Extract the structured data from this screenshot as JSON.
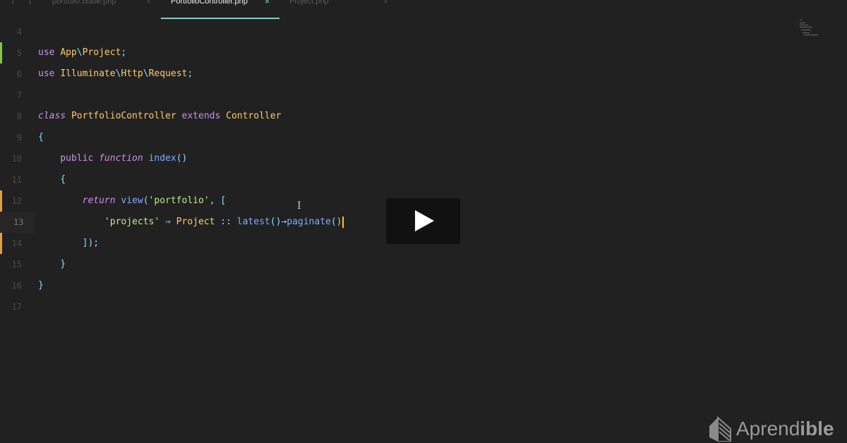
{
  "tabs": [
    {
      "label": "portfolio.blade.php",
      "active": false
    },
    {
      "label": "PortfolioController.php",
      "active": true
    },
    {
      "label": "Project.php",
      "active": false
    }
  ],
  "close_glyph": "×",
  "nav": {
    "back": "‹",
    "forward": "›"
  },
  "editor": {
    "current_line": 13,
    "lines": [
      {
        "n": "4",
        "tokens": []
      },
      {
        "n": "5",
        "gutter": "#8bc34a",
        "tokens": [
          [
            "use ",
            "k"
          ],
          [
            "App",
            "c"
          ],
          [
            "\\",
            "p"
          ],
          [
            "Project",
            "c"
          ],
          [
            ";",
            "p"
          ]
        ]
      },
      {
        "n": "6",
        "tokens": [
          [
            "use ",
            "k"
          ],
          [
            "Illuminate",
            "c"
          ],
          [
            "\\",
            "p"
          ],
          [
            "Http",
            "c"
          ],
          [
            "\\",
            "p"
          ],
          [
            "Request",
            "c"
          ],
          [
            ";",
            "p"
          ]
        ]
      },
      {
        "n": "7",
        "tokens": []
      },
      {
        "n": "8",
        "tokens": [
          [
            "class ",
            "ki"
          ],
          [
            "PortfolioController ",
            "c"
          ],
          [
            "extends ",
            "k"
          ],
          [
            "Controller",
            "c"
          ]
        ]
      },
      {
        "n": "9",
        "tokens": [
          [
            "{",
            "p"
          ]
        ]
      },
      {
        "n": "10",
        "tokens": [
          [
            "    public ",
            "k"
          ],
          [
            "function ",
            "ki"
          ],
          [
            "index",
            "f"
          ],
          [
            "()",
            "p"
          ]
        ]
      },
      {
        "n": "11",
        "tokens": [
          [
            "    {",
            "p"
          ]
        ]
      },
      {
        "n": "12",
        "gutter": "#e0a040",
        "tokens": [
          [
            "        return ",
            "ki"
          ],
          [
            "view",
            "f"
          ],
          [
            "(",
            "p"
          ],
          [
            "'portfolio'",
            "s"
          ],
          [
            ", [",
            "p"
          ]
        ]
      },
      {
        "n": "13",
        "gutter": "#e0a040",
        "tokens": [
          [
            "            'projects'",
            "s"
          ],
          [
            " ⇒ ",
            "p"
          ],
          [
            "Project",
            "c"
          ],
          [
            " :: ",
            "p"
          ],
          [
            "latest",
            "f"
          ],
          [
            "()→",
            "p"
          ],
          [
            "paginate",
            "f"
          ],
          [
            "()",
            "p"
          ]
        ]
      },
      {
        "n": "14",
        "gutter": "#e0a040",
        "tokens": [
          [
            "        ]);",
            "p"
          ]
        ]
      },
      {
        "n": "15",
        "tokens": [
          [
            "    }",
            "p"
          ]
        ]
      },
      {
        "n": "16",
        "tokens": [
          [
            "}",
            "p"
          ]
        ]
      },
      {
        "n": "17",
        "tokens": []
      }
    ]
  },
  "video": {
    "play_label": "Play"
  },
  "brand": {
    "name": "Aprendible",
    "part1": "Aprend",
    "part2": "ible"
  }
}
